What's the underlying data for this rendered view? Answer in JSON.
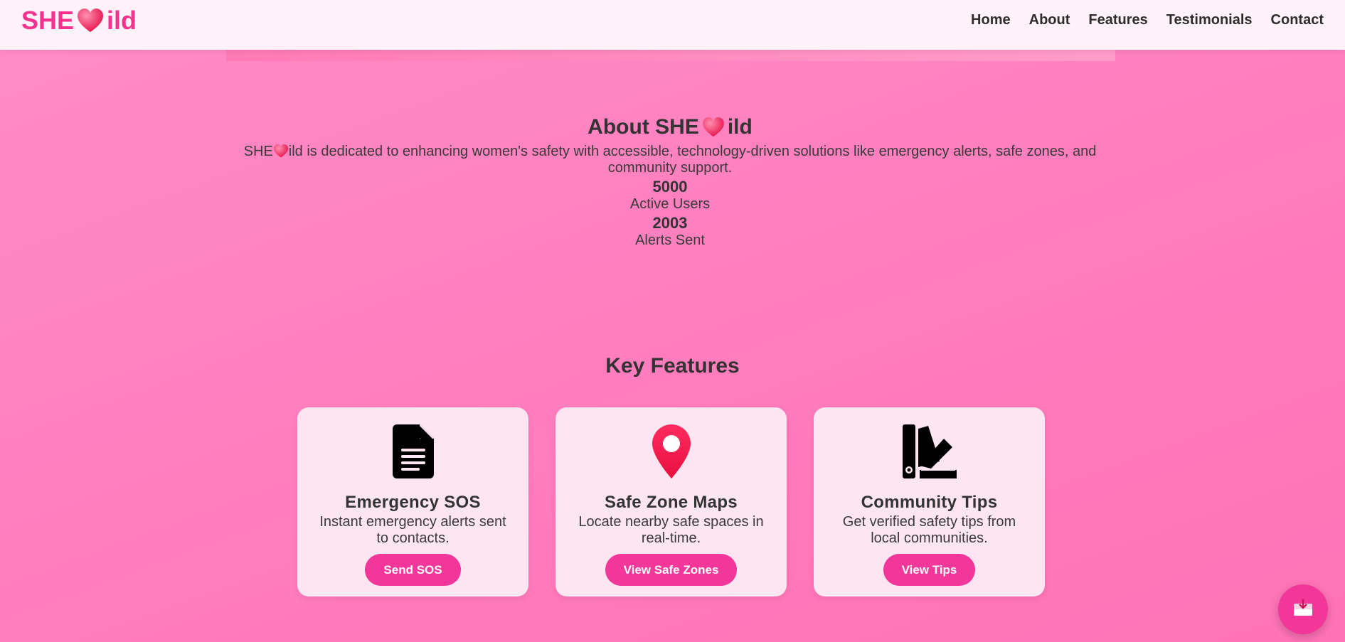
{
  "nav": {
    "logo_prefix": "SHE",
    "logo_suffix": "ild",
    "links": [
      "Home",
      "About",
      "Features",
      "Testimonials",
      "Contact"
    ]
  },
  "about": {
    "title_prefix": "About SHE",
    "title_suffix": "ild",
    "desc_prefix": "SHE",
    "desc_suffix": "ild is dedicated to enhancing women's safety with accessible, technology-driven solutions like emergency alerts, safe zones, and community support.",
    "stats": [
      {
        "value": "5000",
        "label": "Active Users"
      },
      {
        "value": "2003",
        "label": "Alerts Sent"
      }
    ]
  },
  "features": {
    "title": "Key Features",
    "cards": [
      {
        "icon": "document-icon",
        "title": "Emergency SOS",
        "desc": "Instant emergency alerts sent to contacts.",
        "button": "Send SOS"
      },
      {
        "icon": "map-pin-icon",
        "title": "Safe Zone Maps",
        "desc": "Locate nearby safe spaces in real-time.",
        "button": "View Safe Zones"
      },
      {
        "icon": "swatchbook-icon",
        "title": "Community Tips",
        "desc": "Get verified safety tips from local communities.",
        "button": "View Tips"
      }
    ]
  },
  "colors": {
    "brand": "#f5338f",
    "button": "#f2369a",
    "card_bg": "#fde6f1",
    "nav_bg": "#fff3f9",
    "pin": "#ff1f5a"
  },
  "fab_icon": "inbox-icon"
}
